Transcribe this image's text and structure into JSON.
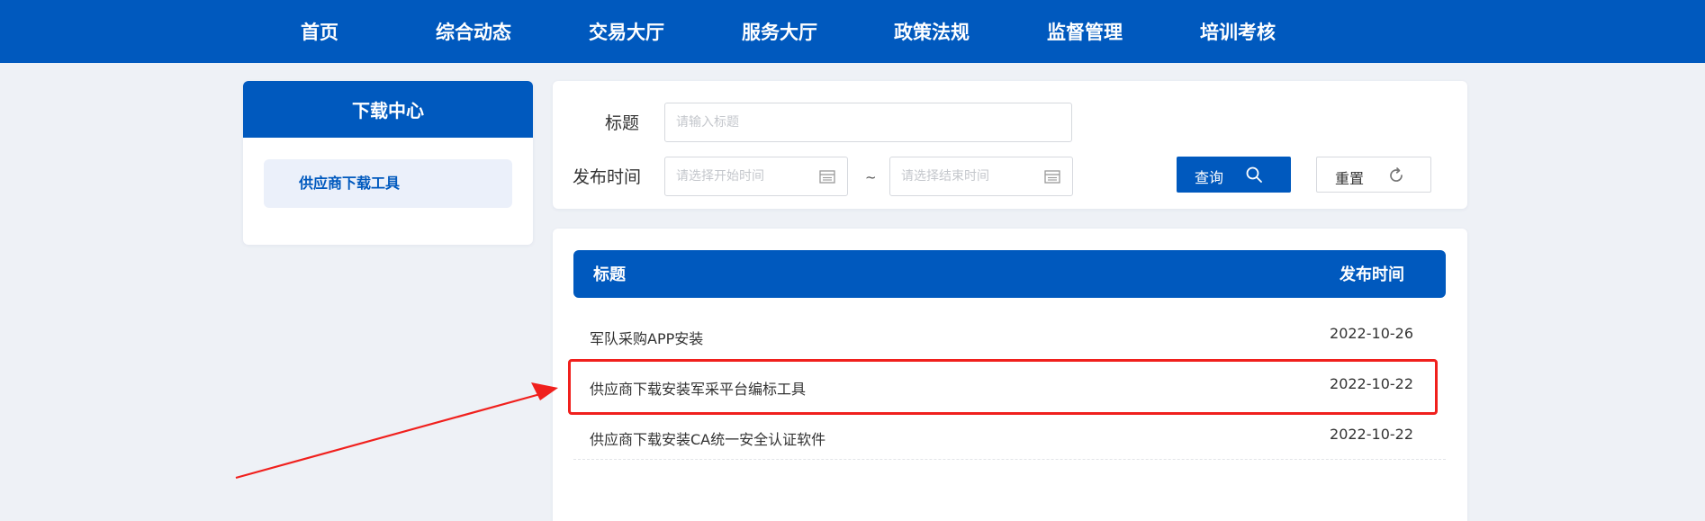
{
  "nav": {
    "items": [
      "首页",
      "综合动态",
      "交易大厅",
      "服务大厅",
      "政策法规",
      "监督管理",
      "培训考核"
    ]
  },
  "sidebar": {
    "title": "下载中心",
    "items": [
      {
        "label": "供应商下载工具"
      }
    ]
  },
  "search": {
    "title_label": "标题",
    "title_placeholder": "请输入标题",
    "time_label": "发布时间",
    "start_placeholder": "请选择开始时间",
    "separator": "~",
    "end_placeholder": "请选择结束时间",
    "query_label": "查询",
    "reset_label": "重置"
  },
  "table": {
    "headers": {
      "title": "标题",
      "date": "发布时间"
    },
    "rows": [
      {
        "title": "军队采购APP安装",
        "date": "2022-10-26"
      },
      {
        "title": "供应商下载安装军采平台编标工具",
        "date": "2022-10-22"
      },
      {
        "title": "供应商下载安装CA统一安全认证软件",
        "date": "2022-10-22"
      }
    ]
  },
  "annotation": {
    "highlighted_row_index": 1,
    "color": "#f0201d"
  },
  "colors": {
    "brand": "#0059be",
    "background": "#eef1f6",
    "sidebar_active_bg": "#ebf0fa"
  }
}
